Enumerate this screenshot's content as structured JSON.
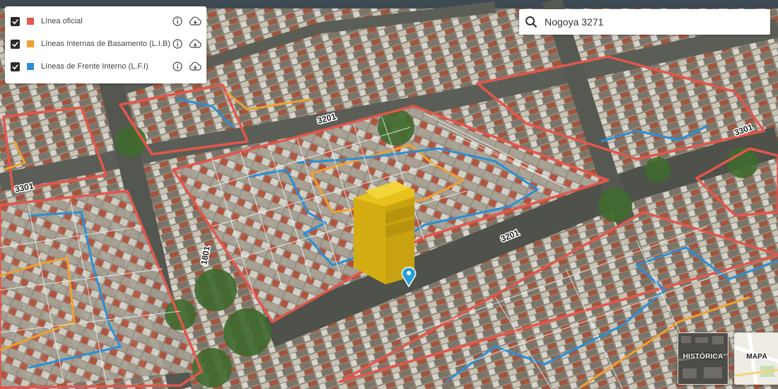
{
  "legend": {
    "items": [
      {
        "label": "Línea oficial",
        "color": "#e2574c",
        "checked": true
      },
      {
        "label": "Líneas Internas de Basamento (L.I.B)",
        "color": "#f0a030",
        "checked": true
      },
      {
        "label": "Líneas de Frente Interno (L.F.I)",
        "color": "#2a8fd6",
        "checked": true
      }
    ]
  },
  "search": {
    "value": "Nogoya 3271",
    "placeholder": ""
  },
  "map": {
    "street_labels": [
      "3301",
      "3201",
      "1801",
      "3201",
      "3301"
    ],
    "marker_color": "#2a9fd6",
    "building_color": "#e8c21c"
  },
  "basemaps": [
    {
      "label": "HISTÓRICA",
      "selected": false
    },
    {
      "label": "MAPA",
      "selected": false
    }
  ]
}
